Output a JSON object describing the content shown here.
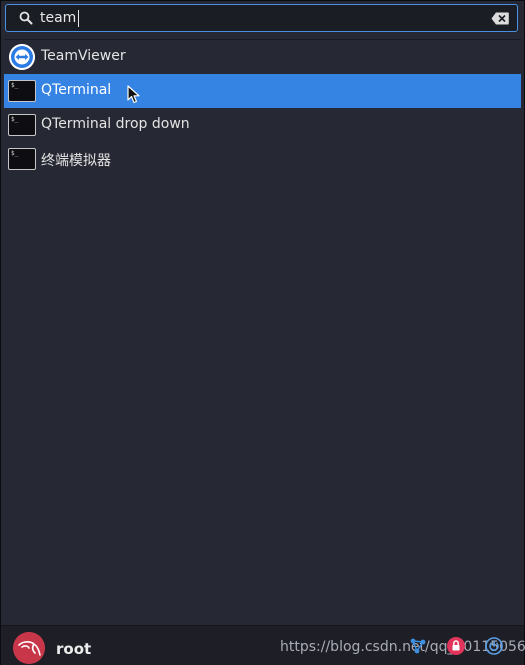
{
  "search": {
    "value": "team",
    "placeholder": ""
  },
  "results": [
    {
      "label": "TeamViewer",
      "icon": "teamviewer-icon",
      "selected": false
    },
    {
      "label": "QTerminal",
      "icon": "terminal-icon",
      "selected": true
    },
    {
      "label": "QTerminal drop down",
      "icon": "terminal-icon",
      "selected": false
    },
    {
      "label": "终端模拟器",
      "icon": "terminal-icon",
      "selected": false
    }
  ],
  "terminal_prompt": "$_",
  "footer": {
    "username": "root",
    "watermark": "https://blog.csdn.net/qq_40115056",
    "buttons": [
      "settings-network-icon",
      "lock-icon",
      "power-icon"
    ]
  },
  "colors": {
    "background": "#262833",
    "selection": "#3584e4",
    "search_border": "#4a90e2",
    "avatar": "#c8364a",
    "lock_button": "#e0345a",
    "network_button": "#3d8fe0",
    "power_button": "#5aa0e8"
  }
}
